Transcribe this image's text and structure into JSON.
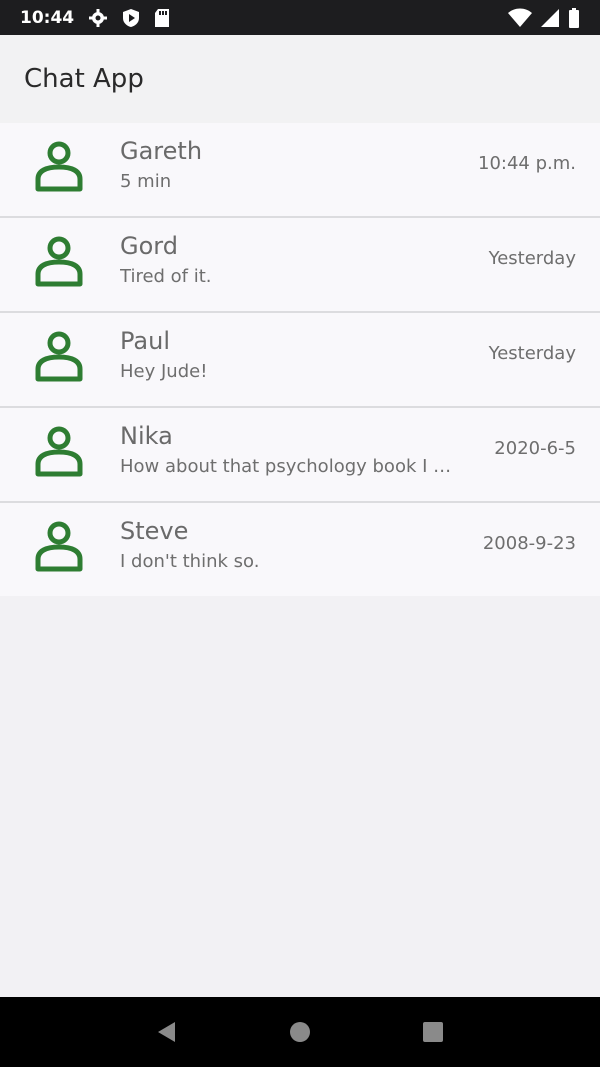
{
  "status_bar": {
    "time": "10:44",
    "icons": [
      "gear-icon",
      "shield-play-icon",
      "sd-card-icon",
      "wifi-icon",
      "signal-icon",
      "battery-icon"
    ]
  },
  "app_bar": {
    "title": "Chat App"
  },
  "chats": [
    {
      "name": "Gareth",
      "preview": "5 min",
      "time": "10:44 p.m."
    },
    {
      "name": "Gord",
      "preview": "Tired of it.",
      "time": "Yesterday"
    },
    {
      "name": "Paul",
      "preview": "Hey Jude!",
      "time": "Yesterday"
    },
    {
      "name": "Nika",
      "preview": "How about that psychology book I …",
      "time": "2020-6-5"
    },
    {
      "name": "Steve",
      "preview": "I don't think so.",
      "time": "2008-9-23"
    }
  ],
  "nav_bar": {
    "icons": [
      "back-icon",
      "home-icon",
      "recents-icon"
    ]
  },
  "colors": {
    "avatar": "#2e7d32",
    "list_bg": "#f9f8fb",
    "divider": "#dcdcdf"
  }
}
